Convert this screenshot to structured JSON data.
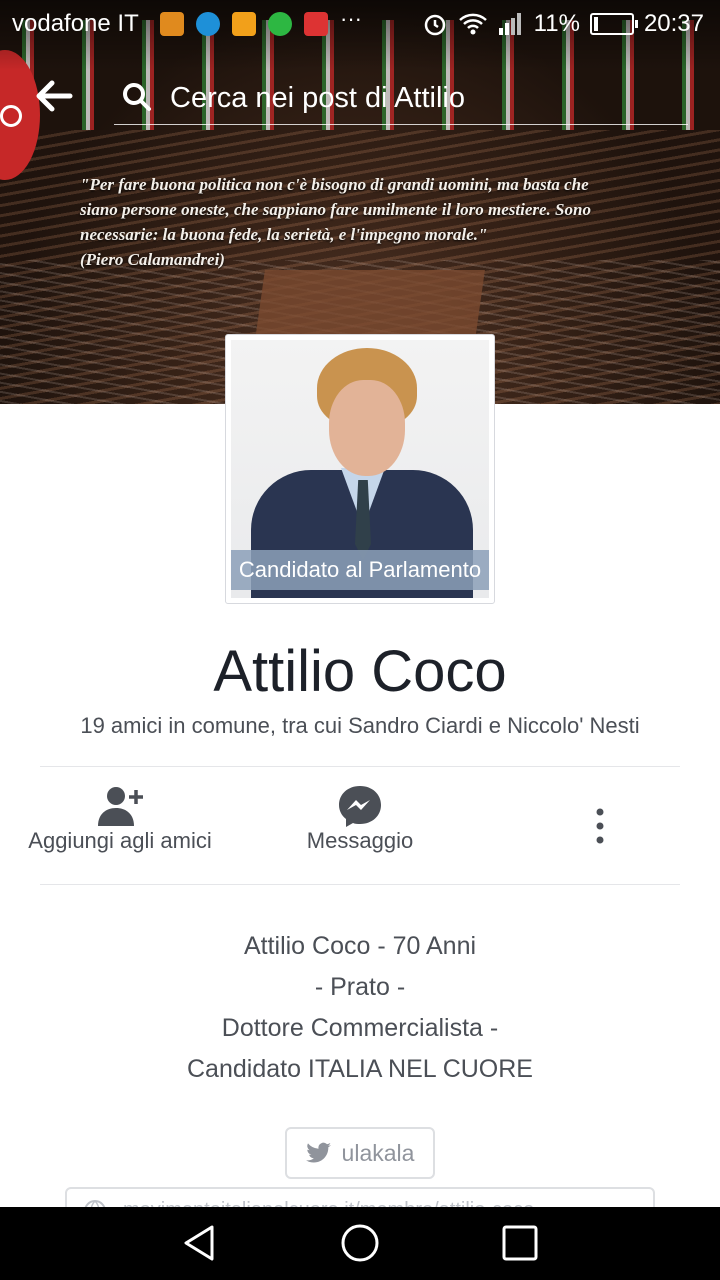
{
  "status_bar": {
    "carrier": "vodafone IT",
    "battery_percent": "11%",
    "time": "20:37",
    "battery_level": 0.11
  },
  "cover": {
    "quote_lines": [
      "\"Per fare buona politica non c'è bisogno di grandi uomini, ma basta che",
      "siano persone oneste, che sappiano fare umilmente il loro mestiere. Sono",
      "necessarie: la buona fede, la serietà, e l'impegno morale.\"",
      "(Piero Calamandrei)"
    ]
  },
  "search": {
    "placeholder": "Cerca nei post di Attilio"
  },
  "profile": {
    "photo_caption": "Candidato al Parlamento",
    "name": "Attilio Coco",
    "mutual_friends": "19 amici in comune, tra cui Sandro Ciardi e Niccolo' Nesti"
  },
  "actions": {
    "add_friend_label": "Aggiungi agli amici",
    "message_label": "Messaggio",
    "icons": [
      "add-friend-icon",
      "messenger-icon",
      "more-vertical-icon"
    ]
  },
  "bio": {
    "lines": [
      "Attilio Coco - 70 Anni",
      "- Prato -",
      "Dottore Commercialista -",
      "Candidato ITALIA NEL CUORE"
    ]
  },
  "links": {
    "twitter_handle": "ulakala",
    "website_text": "movimentoitalianelcuore.it/membro/attilio-coco"
  },
  "colors": {
    "text_primary": "#1d2129",
    "text_secondary": "#4b4f56",
    "icon_gray": "#4b4f56",
    "chip_border": "#dddfe2"
  }
}
